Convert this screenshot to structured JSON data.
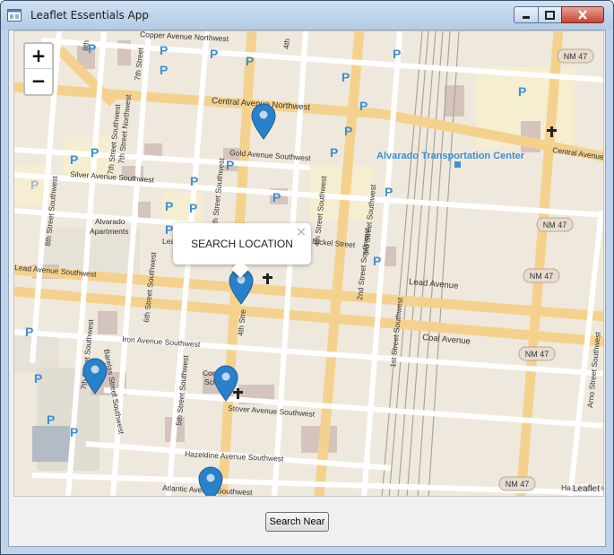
{
  "window": {
    "title": "Leaflet Essentials App",
    "controls": {
      "minimize_icon": "minimize-icon",
      "maximize_icon": "maximize-icon",
      "close_icon": "close-icon"
    }
  },
  "map": {
    "zoom_in_label": "+",
    "zoom_out_label": "−",
    "popup": {
      "text": "SEARCH LOCATION",
      "close_label": "×"
    },
    "attribution": "Leaflet",
    "street_labels": {
      "copper": "Copper Avenue Northwest",
      "central": "Central Avenue Northwest",
      "gold": "Gold Avenue Southwest",
      "silver": "Silver Avenue Southwest",
      "lead": "Lead Avenue",
      "coal": "Coal Avenue",
      "iron": "Iron Avenue Southwest",
      "stover": "Stover Avenue Southwest",
      "hazeldine": "Hazeldine Avenue Southwest",
      "atlantic": "Atlantic Avenue Southwest",
      "lead_avenue_sw": "Lead Avenue Southwest",
      "central_avenue": "Central Avenue",
      "hazeldine_east": "Hazeldine Ave",
      "lea": "Lea",
      "nickel": "Nickel Street",
      "seventh": "7th Street Southwest",
      "fifth": "5th Street Southwest",
      "sixth": "6th Street Southwest",
      "eighth": "8th Street Southwest",
      "third": "3rd Street Southwest",
      "second": "2nd Street Southwest",
      "first": "1st Street Southwest",
      "fourth": "4th Stre",
      "fourth_top": "4th",
      "eighth_top": "8th",
      "seventh_top": "7th Street",
      "seventh_nw": "7th Street Northwest",
      "barelas": "Barelas Street Southwest",
      "arno": "Arno Street Southwest",
      "fourth_sw_east": "4th Street Southwest"
    },
    "poi_labels": {
      "transport": "Alvarado Transportation Center",
      "apartments_1": "Alvarado",
      "apartments_2": "Apartments",
      "school_1": "Coron",
      "school_2": "Scho"
    },
    "shields": {
      "nm47": "NM 47"
    },
    "parking_label": "P",
    "marker_count": 5,
    "accent_color": "#2981ca",
    "marker_icon": "map-marker-icon",
    "church_icon": "church-icon"
  },
  "footer": {
    "search_button": "Search Near"
  }
}
